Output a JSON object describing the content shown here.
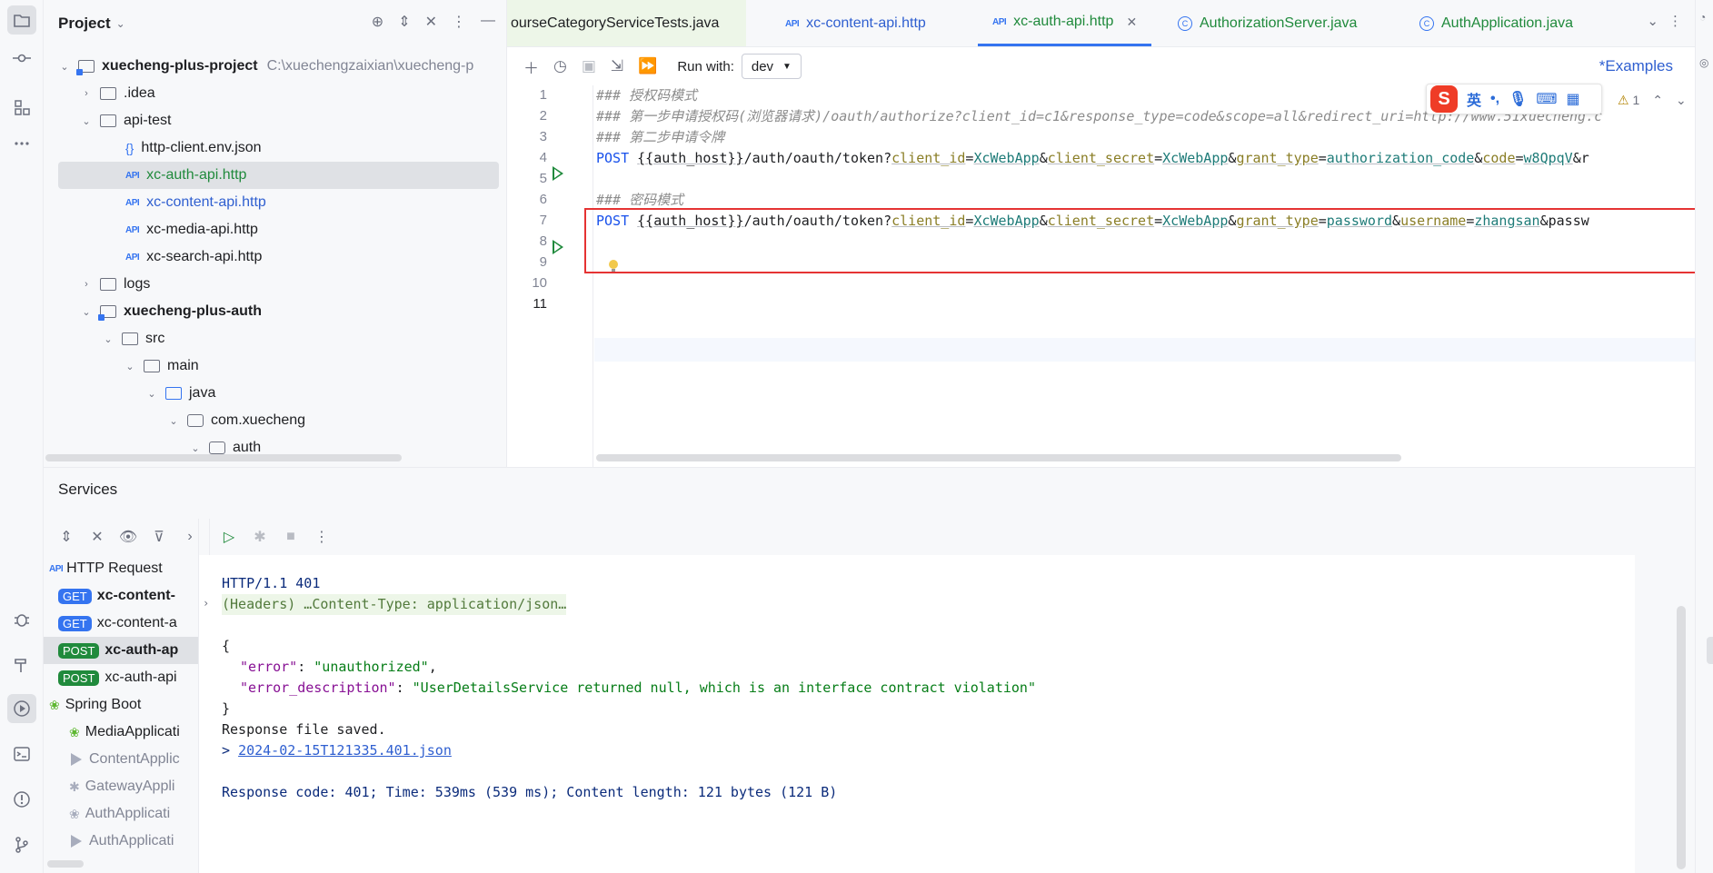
{
  "project": {
    "title": "Project",
    "tree": [
      {
        "label": "xuecheng-plus-project",
        "path": "C:\\xuechengzaixian\\xuecheng-p"
      },
      {
        "label": ".idea"
      },
      {
        "label": "api-test"
      },
      {
        "label": "http-client.env.json"
      },
      {
        "label": "xc-auth-api.http"
      },
      {
        "label": "xc-content-api.http"
      },
      {
        "label": "xc-media-api.http"
      },
      {
        "label": "xc-search-api.http"
      },
      {
        "label": "logs"
      },
      {
        "label": "xuecheng-plus-auth"
      },
      {
        "label": "src"
      },
      {
        "label": "main"
      },
      {
        "label": "java"
      },
      {
        "label": "com.xuecheng"
      },
      {
        "label": "auth"
      }
    ]
  },
  "tabs": [
    {
      "label": "ourseCategoryServiceTests.java"
    },
    {
      "label": "xc-content-api.http"
    },
    {
      "label": "xc-auth-api.http",
      "active": true
    },
    {
      "label": "AuthorizationServer.java"
    },
    {
      "label": "AuthApplication.java"
    }
  ],
  "toolbar": {
    "run_with_label": "Run with:",
    "env": "dev",
    "examples": "*Examples"
  },
  "ime": {
    "lang": "英",
    "punct": "•,"
  },
  "inspections": {
    "count": "1"
  },
  "editor": {
    "line_numbers": [
      "1",
      "2",
      "3",
      "4",
      "5",
      "6",
      "7",
      "8",
      "9",
      "10",
      "11"
    ],
    "l1": "### 授权码模式",
    "l2": "### 第一步申请授权码(浏览器请求)/oauth/authorize?client_id=c1&response_type=code&scope=all&redirect_uri=http://www.51xuecheng.c",
    "l3": "### 第二步申请令牌",
    "l6": "### 密码模式",
    "method": "POST",
    "host_var": "{{auth_host}}",
    "token_path": "/auth/oauth/token?",
    "l4": {
      "p1n": "client_id",
      "p1v": "XcWebApp",
      "p2n": "client_secret",
      "p2v": "XcWebApp",
      "p3n": "grant_type",
      "p3v": "authorization_code",
      "p4n": "code",
      "p4v": "w8QpqV",
      "tail": "&r"
    },
    "l7": {
      "p1n": "client_id",
      "p1v": "XcWebApp",
      "p2n": "client_secret",
      "p2v": "XcWebApp",
      "p3n": "grant_type",
      "p3v": "password",
      "p4n": "username",
      "p4v": "zhangsan",
      "tail": "&passw"
    }
  },
  "services": {
    "title": "Services",
    "tree": {
      "http_request": "HTTP Request",
      "items": [
        {
          "method": "GET",
          "label": "xc-content-"
        },
        {
          "method": "GET",
          "label": "xc-content-a"
        },
        {
          "method": "POST",
          "label": "xc-auth-ap"
        },
        {
          "method": "POST",
          "label": "xc-auth-api"
        }
      ],
      "spring_boot": "Spring Boot",
      "apps": [
        "MediaApplicati",
        "ContentApplic",
        "GatewayAppli",
        "AuthApplicati",
        "AuthApplicati"
      ]
    },
    "console": {
      "status": "HTTP/1.1 401",
      "headers": "(Headers) …Content-Type: application/json…",
      "open": "{",
      "k1": "\"error\"",
      "v1": "\"unauthorized\"",
      "k2": "\"error_description\"",
      "v2": "\"UserDetailsService returned null, which is an interface contract violation\"",
      "close": "}",
      "saved": "Response file saved.",
      "prompt": ">",
      "file": "2024-02-15T121335.401.json",
      "summary": "Response code: 401; Time: 539ms (539 ms); Content length: 121 bytes (121 B)"
    }
  }
}
